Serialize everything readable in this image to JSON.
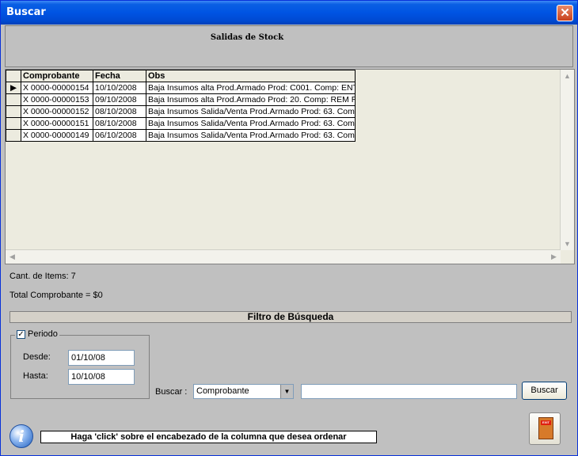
{
  "window": {
    "title": "Buscar",
    "close_glyph": "✕"
  },
  "header": {
    "title": "Salidas de Stock"
  },
  "grid": {
    "columns": [
      "Comprobante",
      "Fecha",
      "Obs"
    ],
    "rows": [
      {
        "comprobante": "X 0000-00000154",
        "fecha": "10/10/2008",
        "obs": "Baja Insumos  alta Prod.Armado Prod: C001. Comp: ENT"
      },
      {
        "comprobante": "X 0000-00000153",
        "fecha": "09/10/2008",
        "obs": "Baja Insumos  alta Prod.Armado Prod: 20. Comp: REM R"
      },
      {
        "comprobante": "X 0000-00000152",
        "fecha": "08/10/2008",
        "obs": "Baja Insumos  Salida/Venta Prod.Armado Prod: 63. Com"
      },
      {
        "comprobante": "X 0000-00000151",
        "fecha": "08/10/2008",
        "obs": "Baja Insumos  Salida/Venta Prod.Armado Prod: 63. Com"
      },
      {
        "comprobante": "X 0000-00000149",
        "fecha": "06/10/2008",
        "obs": "Baja Insumos  Salida/Venta Prod.Armado Prod: 63. Com"
      }
    ],
    "selected_row": 0
  },
  "summary": {
    "items_count": "Cant. de Items: 7",
    "total": "Total Comprobante = $0"
  },
  "filter": {
    "bar_label": "Filtro de Búsqueda",
    "periodo_label": "Periodo",
    "periodo_checked": true,
    "desde_label": "Desde:",
    "desde_value": "01/10/08",
    "hasta_label": "Hasta:",
    "hasta_value": "10/10/08",
    "buscar_label": "Buscar :",
    "buscar_combo_value": "Comprobante",
    "buscar_text_value": "",
    "buscar_button": "Buscar"
  },
  "footer": {
    "info_glyph": "i",
    "hint": "Haga 'click' sobre el encabezado de la columna que desea ordenar",
    "exit_sign": "EXIT"
  },
  "colors": {
    "titlebar": "#0054e3",
    "panel": "#c0c0c0",
    "grid_bg": "#ecebdf"
  }
}
